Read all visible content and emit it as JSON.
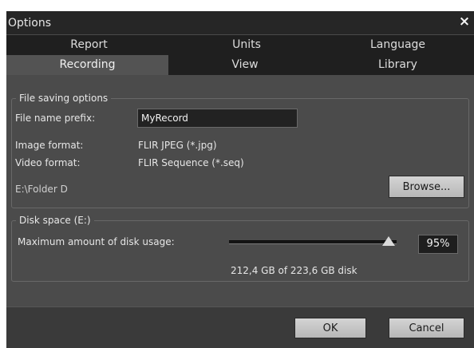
{
  "window": {
    "title": "Options",
    "close_glyph": "×"
  },
  "tabs": {
    "row1": [
      {
        "label": "Report"
      },
      {
        "label": "Units"
      },
      {
        "label": "Language"
      }
    ],
    "row2": [
      {
        "label": "Recording",
        "active": true
      },
      {
        "label": "View"
      },
      {
        "label": "Library"
      }
    ]
  },
  "file_saving": {
    "legend": "File saving options",
    "prefix_label": "File name prefix:",
    "prefix_value": "MyRecord",
    "image_format_label": "Image format:",
    "image_format_value": "FLIR JPEG (*.jpg)",
    "video_format_label": "Video format:",
    "video_format_value": "FLIR Sequence (*.seq)",
    "folder_path": "E:\\Folder D",
    "browse_label": "Browse..."
  },
  "disk_space": {
    "legend": "Disk space (E:)",
    "max_usage_label": "Maximum amount of disk usage:",
    "usage_percent": 95,
    "usage_percent_text": "95%",
    "disk_summary": "212,4 GB of 223,6 GB disk"
  },
  "footer": {
    "ok_label": "OK",
    "cancel_label": "Cancel"
  },
  "colors": {
    "title_bar": "#262626",
    "tab_inactive": "#1f1f1f",
    "tab_active": "#535353",
    "panel": "#4b4b4b"
  }
}
